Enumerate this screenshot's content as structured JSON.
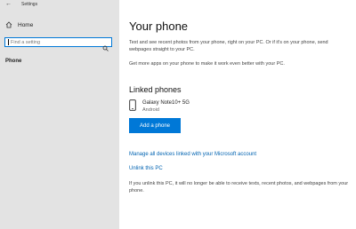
{
  "window": {
    "title": "Settings"
  },
  "sidebar": {
    "home_label": "Home",
    "search": {
      "placeholder": "Find a setting"
    },
    "nav": {
      "phone_label": "Phone"
    }
  },
  "main": {
    "title": "Your phone",
    "description_1": "Text and see recent photos from your phone, right on your PC. Or if it's on your phone, send webpages straight to your PC.",
    "description_2": "Get more apps on your phone to make it work even better with your PC.",
    "linked_phones": {
      "heading": "Linked phones",
      "device": {
        "name": "Galaxy Note10+ 5G",
        "os": "Android"
      }
    },
    "add_phone_label": "Add a phone",
    "manage_link": "Manage all devices linked with your Microsoft account",
    "unlink_link": "Unlink this PC",
    "unlink_note": "If you unlink this PC, it will no longer be able to receive texts, recent photos, and webpages from your phone."
  },
  "colors": {
    "accent": "#0078d7",
    "link": "#0063b1",
    "sidebar_bg": "#e3e3e3"
  },
  "icons": [
    "back-arrow-icon",
    "home-icon",
    "search-icon",
    "phone-icon"
  ]
}
